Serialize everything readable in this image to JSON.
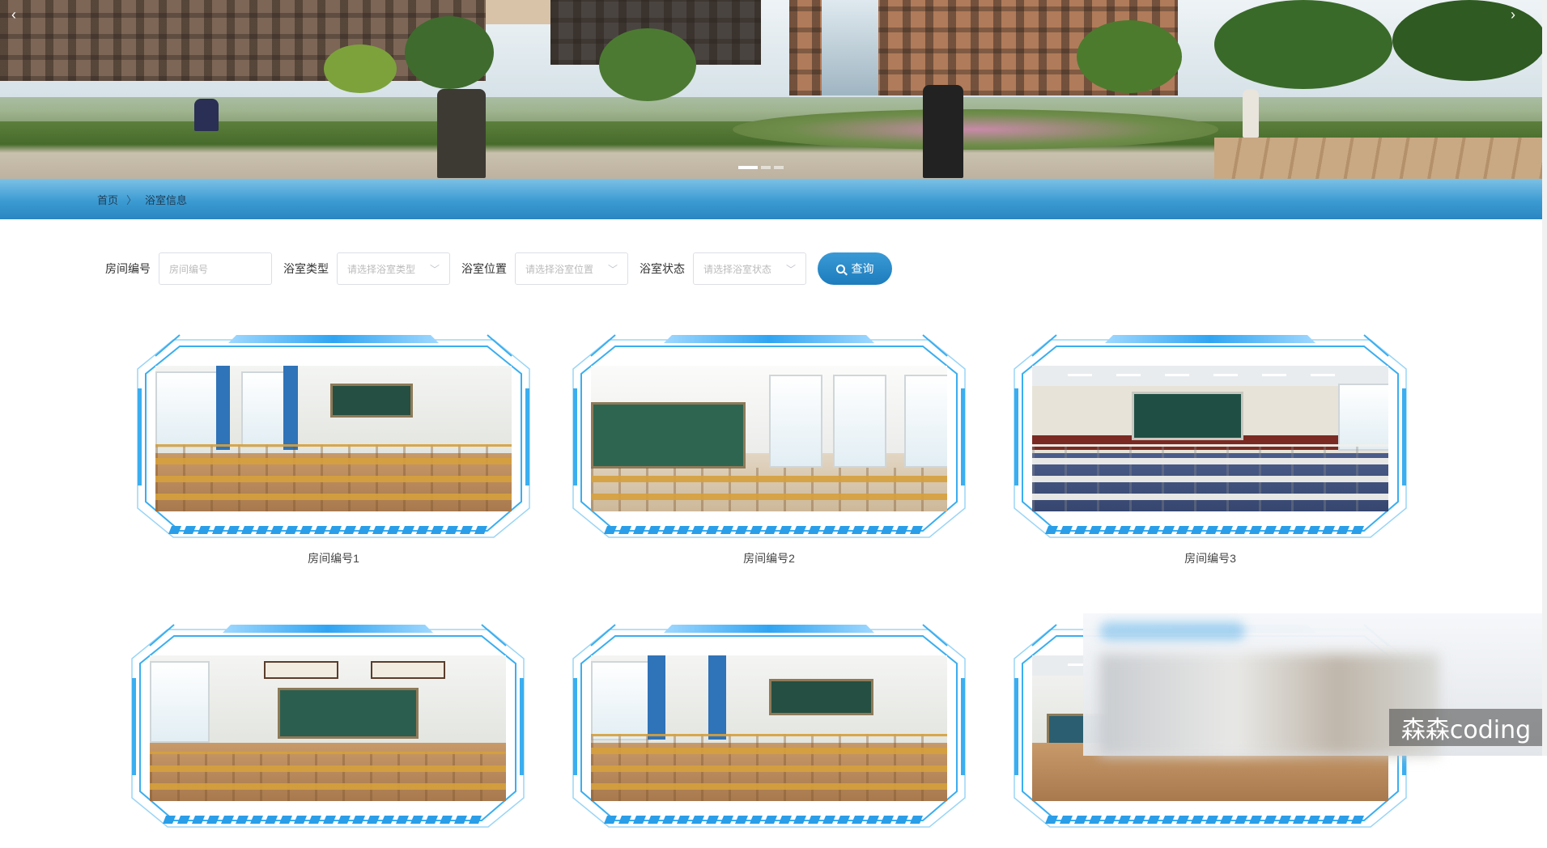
{
  "banner": {
    "prev_icon": "‹",
    "next_icon": "›",
    "dots": 3,
    "active_dot": 0
  },
  "breadcrumb": {
    "home": "首页",
    "separator": "〉",
    "current": "浴室信息"
  },
  "filters": {
    "room_no_label": "房间编号",
    "room_no_placeholder": "房间编号",
    "type_label": "浴室类型",
    "type_placeholder": "请选择浴室类型",
    "location_label": "浴室位置",
    "location_placeholder": "请选择浴室位置",
    "status_label": "浴室状态",
    "status_placeholder": "请选择浴室状态",
    "search_button": "查询"
  },
  "cards": [
    {
      "caption": "房间编号1"
    },
    {
      "caption": "房间编号2"
    },
    {
      "caption": "房间编号3"
    },
    {
      "caption": ""
    },
    {
      "caption": ""
    },
    {
      "caption": ""
    }
  ],
  "watermark": "森森coding",
  "colors": {
    "accent": "#2a86c1",
    "frame": "#3aaef0"
  }
}
